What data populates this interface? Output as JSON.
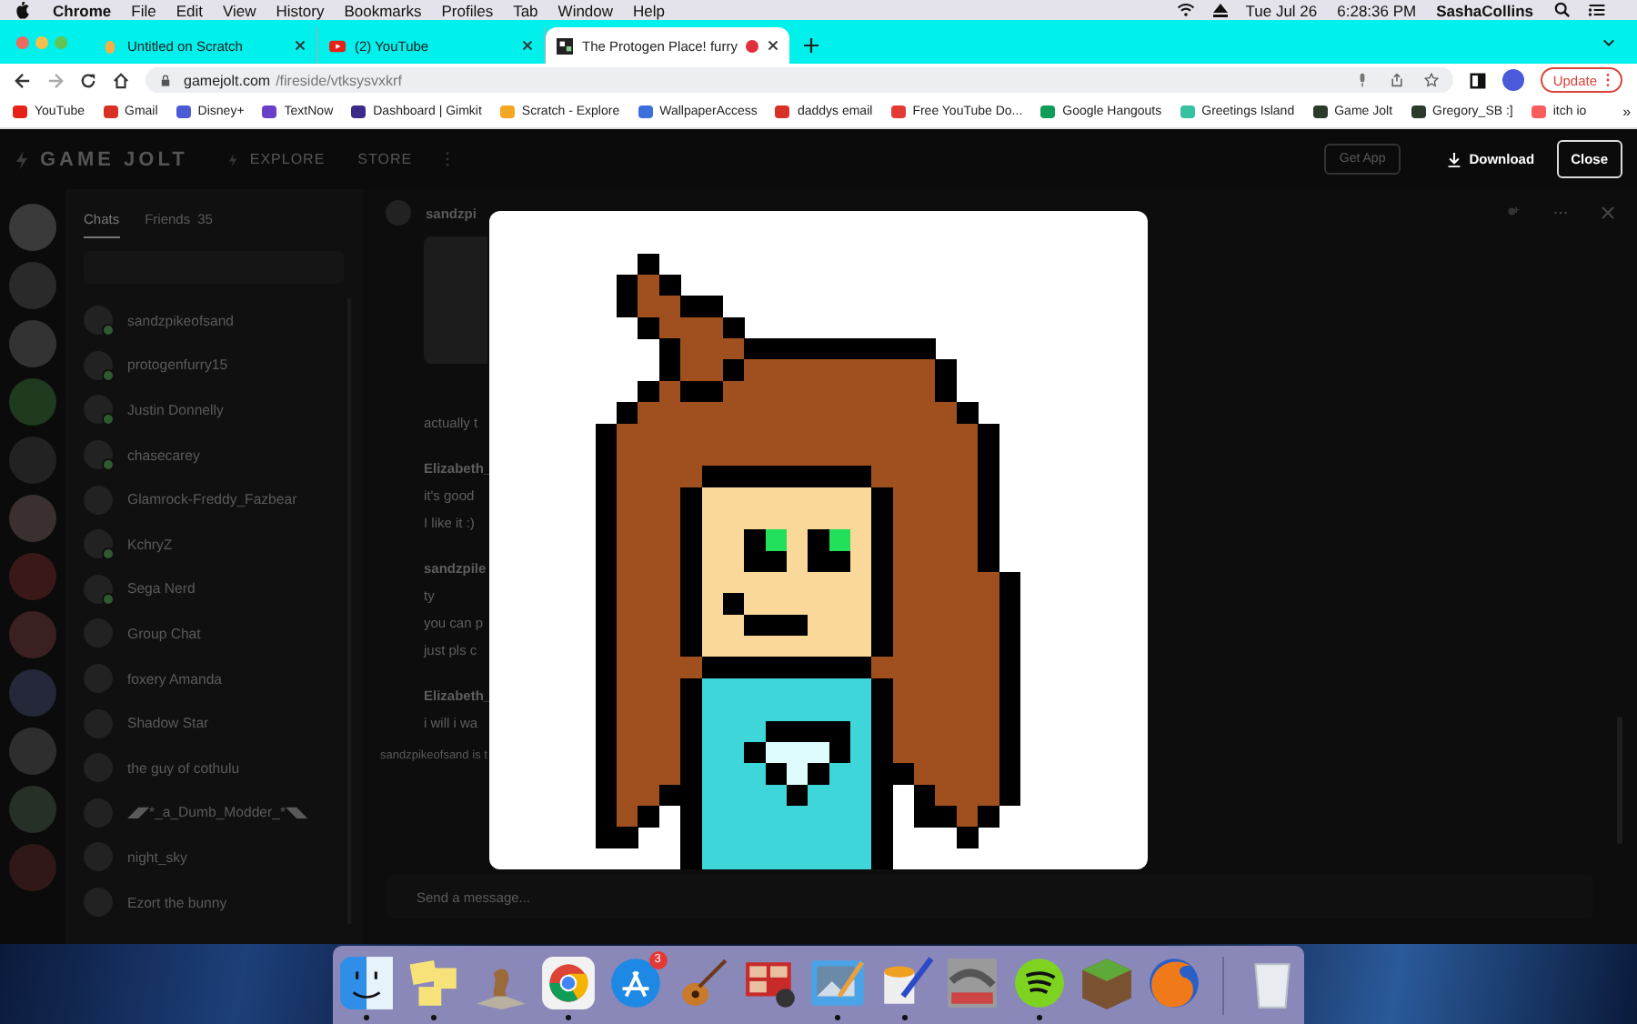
{
  "menu_bar": {
    "app": "Chrome",
    "menus": [
      "File",
      "Edit",
      "View",
      "History",
      "Bookmarks",
      "Profiles",
      "Tab",
      "Window",
      "Help"
    ],
    "date": "Tue Jul 26",
    "time": "6:28:36 PM",
    "user": "SashaCollins"
  },
  "tabs": [
    {
      "title": "Untitled on Scratch",
      "kind": "scratch",
      "selected": false,
      "recording": false
    },
    {
      "title": "(2) YouTube",
      "kind": "video",
      "selected": false,
      "recording": false
    },
    {
      "title": "The Protogen Place! furry",
      "kind": "pixel",
      "selected": true,
      "recording": true
    }
  ],
  "address_bar": {
    "host": "gamejolt.com",
    "path": "/fireside/vtksysvxkrf"
  },
  "update_button": "Update",
  "bookmarks": [
    {
      "label": "YouTube",
      "color": "#e62117"
    },
    {
      "label": "Gmail",
      "color": "#d93025"
    },
    {
      "label": "Disney+",
      "color": "#4b5bd6"
    },
    {
      "label": "TextNow",
      "color": "#6a3fc8"
    },
    {
      "label": "Dashboard | Gimkit",
      "color": "#3b2a8a"
    },
    {
      "label": "Scratch - Explore",
      "color": "#f5a623"
    },
    {
      "label": "WallpaperAccess",
      "color": "#3b6fd9"
    },
    {
      "label": "daddys email",
      "color": "#d93025"
    },
    {
      "label": "Free YouTube Do...",
      "color": "#e53935"
    },
    {
      "label": "Google Hangouts",
      "color": "#0f9d58"
    },
    {
      "label": "Greetings Island",
      "color": "#36c2a0"
    },
    {
      "label": "Game Jolt",
      "color": "#2b3a2b"
    },
    {
      "label": "Gregory_SB :]",
      "color": "#2b3a2b"
    },
    {
      "label": "itch io",
      "color": "#fa5c5c"
    }
  ],
  "bookmarks_more": "»",
  "site": {
    "logo": "GAME JOLT",
    "nav": [
      "EXPLORE",
      "STORE"
    ],
    "get_app": "Get App",
    "download": "Download",
    "close": "Close"
  },
  "chat_tabs": [
    {
      "label": "Chats",
      "selected": true
    },
    {
      "label": "Friends",
      "count": "35",
      "selected": false
    }
  ],
  "chats": [
    {
      "name": "sandzpikeofsand",
      "online": true
    },
    {
      "name": "protogenfurry15",
      "online": true
    },
    {
      "name": "Justin Donnelly",
      "online": true
    },
    {
      "name": "chasecarey",
      "online": true
    },
    {
      "name": "Glamrock-Freddy_Fazbear",
      "online": false
    },
    {
      "name": "KchryZ",
      "online": true
    },
    {
      "name": "Sega Nerd",
      "online": true
    },
    {
      "name": "Group Chat",
      "online": false
    },
    {
      "name": "foxery Amanda",
      "online": false
    },
    {
      "name": "Shadow Star",
      "online": false
    },
    {
      "name": "the guy of cothulu",
      "online": false
    },
    {
      "name": "◢◤*_a_Dumb_Modder_*◥◣",
      "online": false
    },
    {
      "name": "night_sky",
      "online": false
    },
    {
      "name": "Ezort the bunny",
      "online": false
    }
  ],
  "conversation": {
    "name": "sandzpi",
    "messages": [
      {
        "kind": "text",
        "text": "actually t"
      },
      {
        "kind": "author",
        "text": "Elizabeth_"
      },
      {
        "kind": "text",
        "text": "it's good"
      },
      {
        "kind": "text",
        "text": "I like it :)"
      },
      {
        "kind": "author",
        "text": "sandzpile"
      },
      {
        "kind": "text",
        "text": "ty"
      },
      {
        "kind": "text",
        "text": "you can p"
      },
      {
        "kind": "text",
        "text": "just pls c"
      },
      {
        "kind": "author",
        "text": "Elizabeth_"
      },
      {
        "kind": "text",
        "text": "i will i wa"
      }
    ],
    "typing": "sandzpikeofsand is t",
    "placeholder": "Send a message..."
  },
  "dock": [
    {
      "kind": "finder",
      "running": true
    },
    {
      "kind": "notes",
      "running": true
    },
    {
      "kind": "chess",
      "running": false
    },
    {
      "kind": "browser",
      "running": true
    },
    {
      "kind": "store",
      "running": false,
      "badge": "3"
    },
    {
      "kind": "guitar",
      "running": false
    },
    {
      "kind": "photos",
      "running": false
    },
    {
      "kind": "preview",
      "running": true
    },
    {
      "kind": "paint",
      "running": true
    },
    {
      "kind": "game",
      "running": false
    },
    {
      "kind": "music",
      "running": true
    },
    {
      "kind": "grass",
      "running": false
    },
    {
      "kind": "fox",
      "running": false
    },
    {
      "kind": "trash",
      "running": false
    }
  ]
}
